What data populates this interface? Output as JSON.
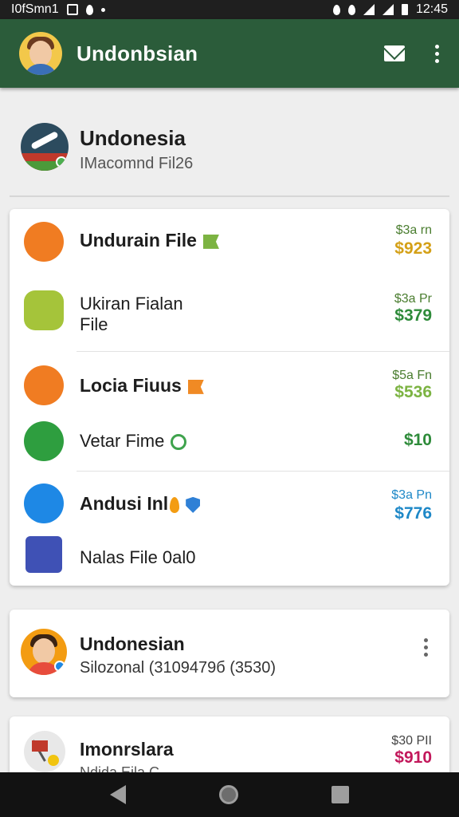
{
  "status_bar": {
    "left_text": "I0fSmn1",
    "time": "12:45"
  },
  "app_bar": {
    "title": "Undonbsian",
    "icons": [
      "avatar",
      "mail-icon",
      "more-vert-icon"
    ]
  },
  "header": {
    "title": "Undonesia",
    "subtitle": "IMacomnd Fil26"
  },
  "files": [
    {
      "label": "Undurain File",
      "price_top": "$3a rn",
      "price": "$923",
      "price_color": "#d4a017",
      "icon_color": "#f07c22",
      "tag": "green-tag-icon"
    },
    {
      "label_line1": "Ukiran Fialan",
      "label_line2": "File",
      "price_top": "$3a Pr",
      "price": "$379",
      "price_color": "#2e8b3a",
      "icon_color": "#a5c43a"
    },
    {
      "label": "Locia Fiuus",
      "price_top": "$5a Fn",
      "price": "$536",
      "price_color": "#7cb342",
      "icon_color": "#f07c22",
      "tag": "orange-tag-icon"
    },
    {
      "label": "Vetar Fime",
      "price": "$10",
      "price_color": "#2e8b3a",
      "icon_color": "#2e9e3f",
      "tag": "circle-plus-icon"
    },
    {
      "label": "Andusi Inl",
      "price_top": "$3a Pn",
      "price": "$776",
      "price_color": "#1e88c7",
      "icon_color": "#1e88e5",
      "tag": "shield-icon"
    },
    {
      "label": "Nalas File 0al0",
      "icon_color": "#3f51b5"
    }
  ],
  "contact": {
    "name": "Undonesian",
    "phone": "Silozonal (3109479б (3530)"
  },
  "last_item": {
    "title": "Imonrslara",
    "subtitle": "Ndida Eila C",
    "price_top": "$30 PII",
    "price": "$910",
    "price_color": "#c2185b"
  },
  "navbar": {
    "icons": [
      "back-icon",
      "home-icon",
      "recents-icon"
    ]
  }
}
